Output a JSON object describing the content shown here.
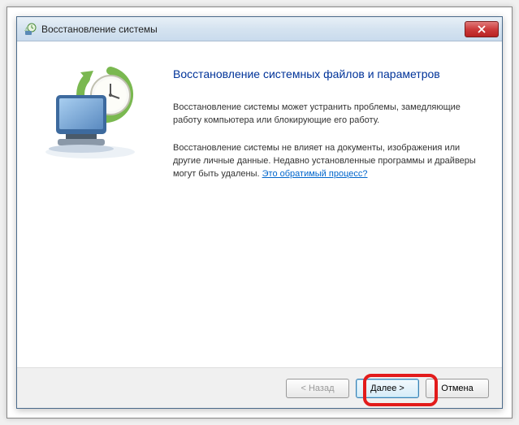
{
  "window": {
    "title": "Восстановление системы"
  },
  "content": {
    "heading": "Восстановление системных файлов и параметров",
    "paragraph1": "Восстановление системы может устранить проблемы, замедляющие работу компьютера или блокирующие его работу.",
    "paragraph2_part1": "Восстановление системы не влияет на документы, изображения или другие личные данные. Недавно установленные программы и драйверы могут быть удалены. ",
    "help_link": "Это обратимый процесс?"
  },
  "buttons": {
    "back": "< Назад",
    "next": "Далее >",
    "cancel": "Отмена"
  }
}
